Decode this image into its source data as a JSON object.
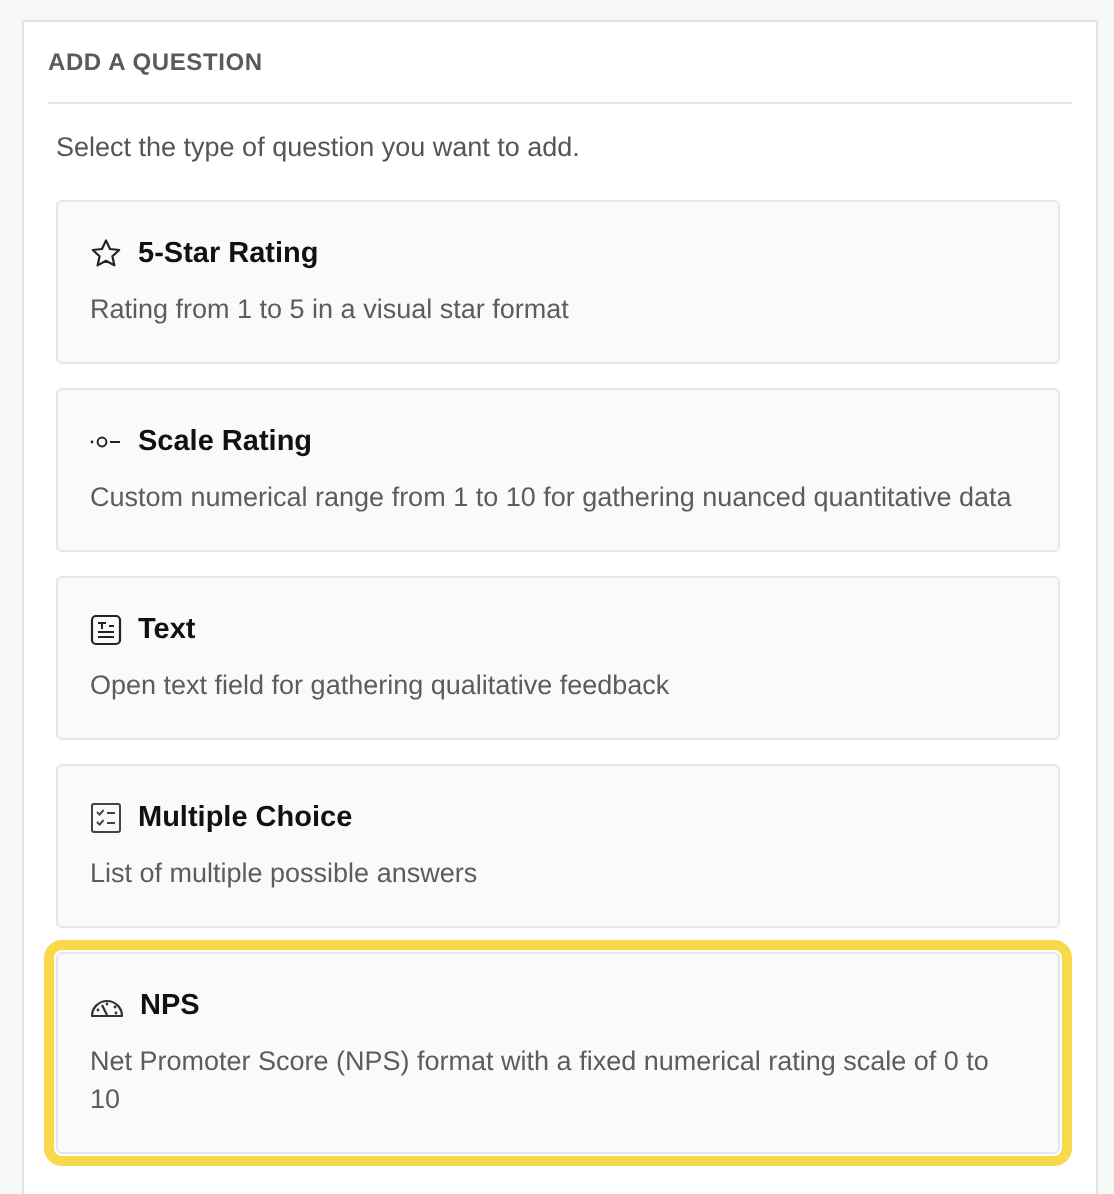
{
  "panel": {
    "title": "ADD A QUESTION",
    "intro": "Select the type of question you want to add."
  },
  "question_types": [
    {
      "kind": "star",
      "title": "5-Star Rating",
      "description": "Rating from 1 to 5 in a visual star format",
      "selected": false
    },
    {
      "kind": "scale",
      "title": "Scale Rating",
      "description": "Custom numerical range from 1 to 10 for gathering nuanced quantitative data",
      "selected": false
    },
    {
      "kind": "text",
      "title": "Text",
      "description": "Open text field for gathering qualitative feedback",
      "selected": false
    },
    {
      "kind": "choice",
      "title": "Multiple Choice",
      "description": "List of multiple possible answers",
      "selected": false
    },
    {
      "kind": "gauge",
      "title": "NPS",
      "description": "Net Promoter Score (NPS) format with a fixed numerical rating scale of 0 to 10",
      "selected": true
    }
  ]
}
